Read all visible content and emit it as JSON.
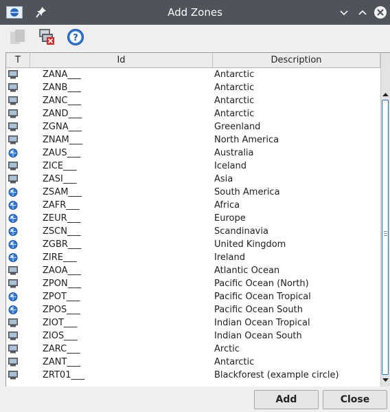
{
  "window": {
    "title": "Add Zones"
  },
  "colors": {
    "titlebar": "#4e5459",
    "accent": "#1e6fd0"
  },
  "toolbar": {
    "buttons": [
      {
        "icon": "copy-icon",
        "enabled": false
      },
      {
        "icon": "remove-zone-icon",
        "enabled": true
      },
      {
        "icon": "help-icon",
        "enabled": true
      }
    ]
  },
  "table": {
    "columns": [
      "T",
      "Id",
      "Description"
    ],
    "rows": [
      {
        "type": "monitor-icon",
        "id": "ZANA___",
        "description": "Antarctic"
      },
      {
        "type": "monitor-icon",
        "id": "ZANB___",
        "description": "Antarctic"
      },
      {
        "type": "monitor-icon",
        "id": "ZANC___",
        "description": "Antarctic"
      },
      {
        "type": "monitor-icon",
        "id": "ZAND___",
        "description": "Antarctic"
      },
      {
        "type": "monitor-icon",
        "id": "ZGNA___",
        "description": "Greenland"
      },
      {
        "type": "monitor-icon",
        "id": "ZNAM___",
        "description": "North America"
      },
      {
        "type": "globe-icon",
        "id": "ZAUS___",
        "description": "Australia"
      },
      {
        "type": "monitor-icon",
        "id": "ZICE___",
        "description": "Iceland"
      },
      {
        "type": "monitor-icon",
        "id": "ZASI___",
        "description": "Asia"
      },
      {
        "type": "globe-icon",
        "id": "ZSAM___",
        "description": "South America"
      },
      {
        "type": "globe-icon",
        "id": "ZAFR___",
        "description": "Africa"
      },
      {
        "type": "globe-icon",
        "id": "ZEUR___",
        "description": "Europe"
      },
      {
        "type": "globe-icon",
        "id": "ZSCN___",
        "description": "Scandinavia"
      },
      {
        "type": "globe-icon",
        "id": "ZGBR___",
        "description": "United Kingdom"
      },
      {
        "type": "globe-icon",
        "id": "ZIRE___",
        "description": "Ireland"
      },
      {
        "type": "monitor-icon",
        "id": "ZAOA___",
        "description": "Atlantic Ocean"
      },
      {
        "type": "monitor-icon",
        "id": "ZPON___",
        "description": "Pacific Ocean (North)"
      },
      {
        "type": "globe-icon",
        "id": "ZPOT___",
        "description": "Pacific Ocean Tropical"
      },
      {
        "type": "globe-icon",
        "id": "ZPOS___",
        "description": "Pacific Ocean South"
      },
      {
        "type": "monitor-icon",
        "id": "ZIOT___",
        "description": "Indian Ocean Tropical"
      },
      {
        "type": "monitor-icon",
        "id": "ZIOS___",
        "description": "Indian Ocean South"
      },
      {
        "type": "monitor-icon",
        "id": "ZARC___",
        "description": "Arctic"
      },
      {
        "type": "monitor-icon",
        "id": "ZANT___",
        "description": "Antarctic"
      },
      {
        "type": "monitor-icon",
        "id": "ZRT01___",
        "description": "Blackforest (example circle)"
      }
    ]
  },
  "footer": {
    "add_label": "Add",
    "close_label": "Close"
  }
}
